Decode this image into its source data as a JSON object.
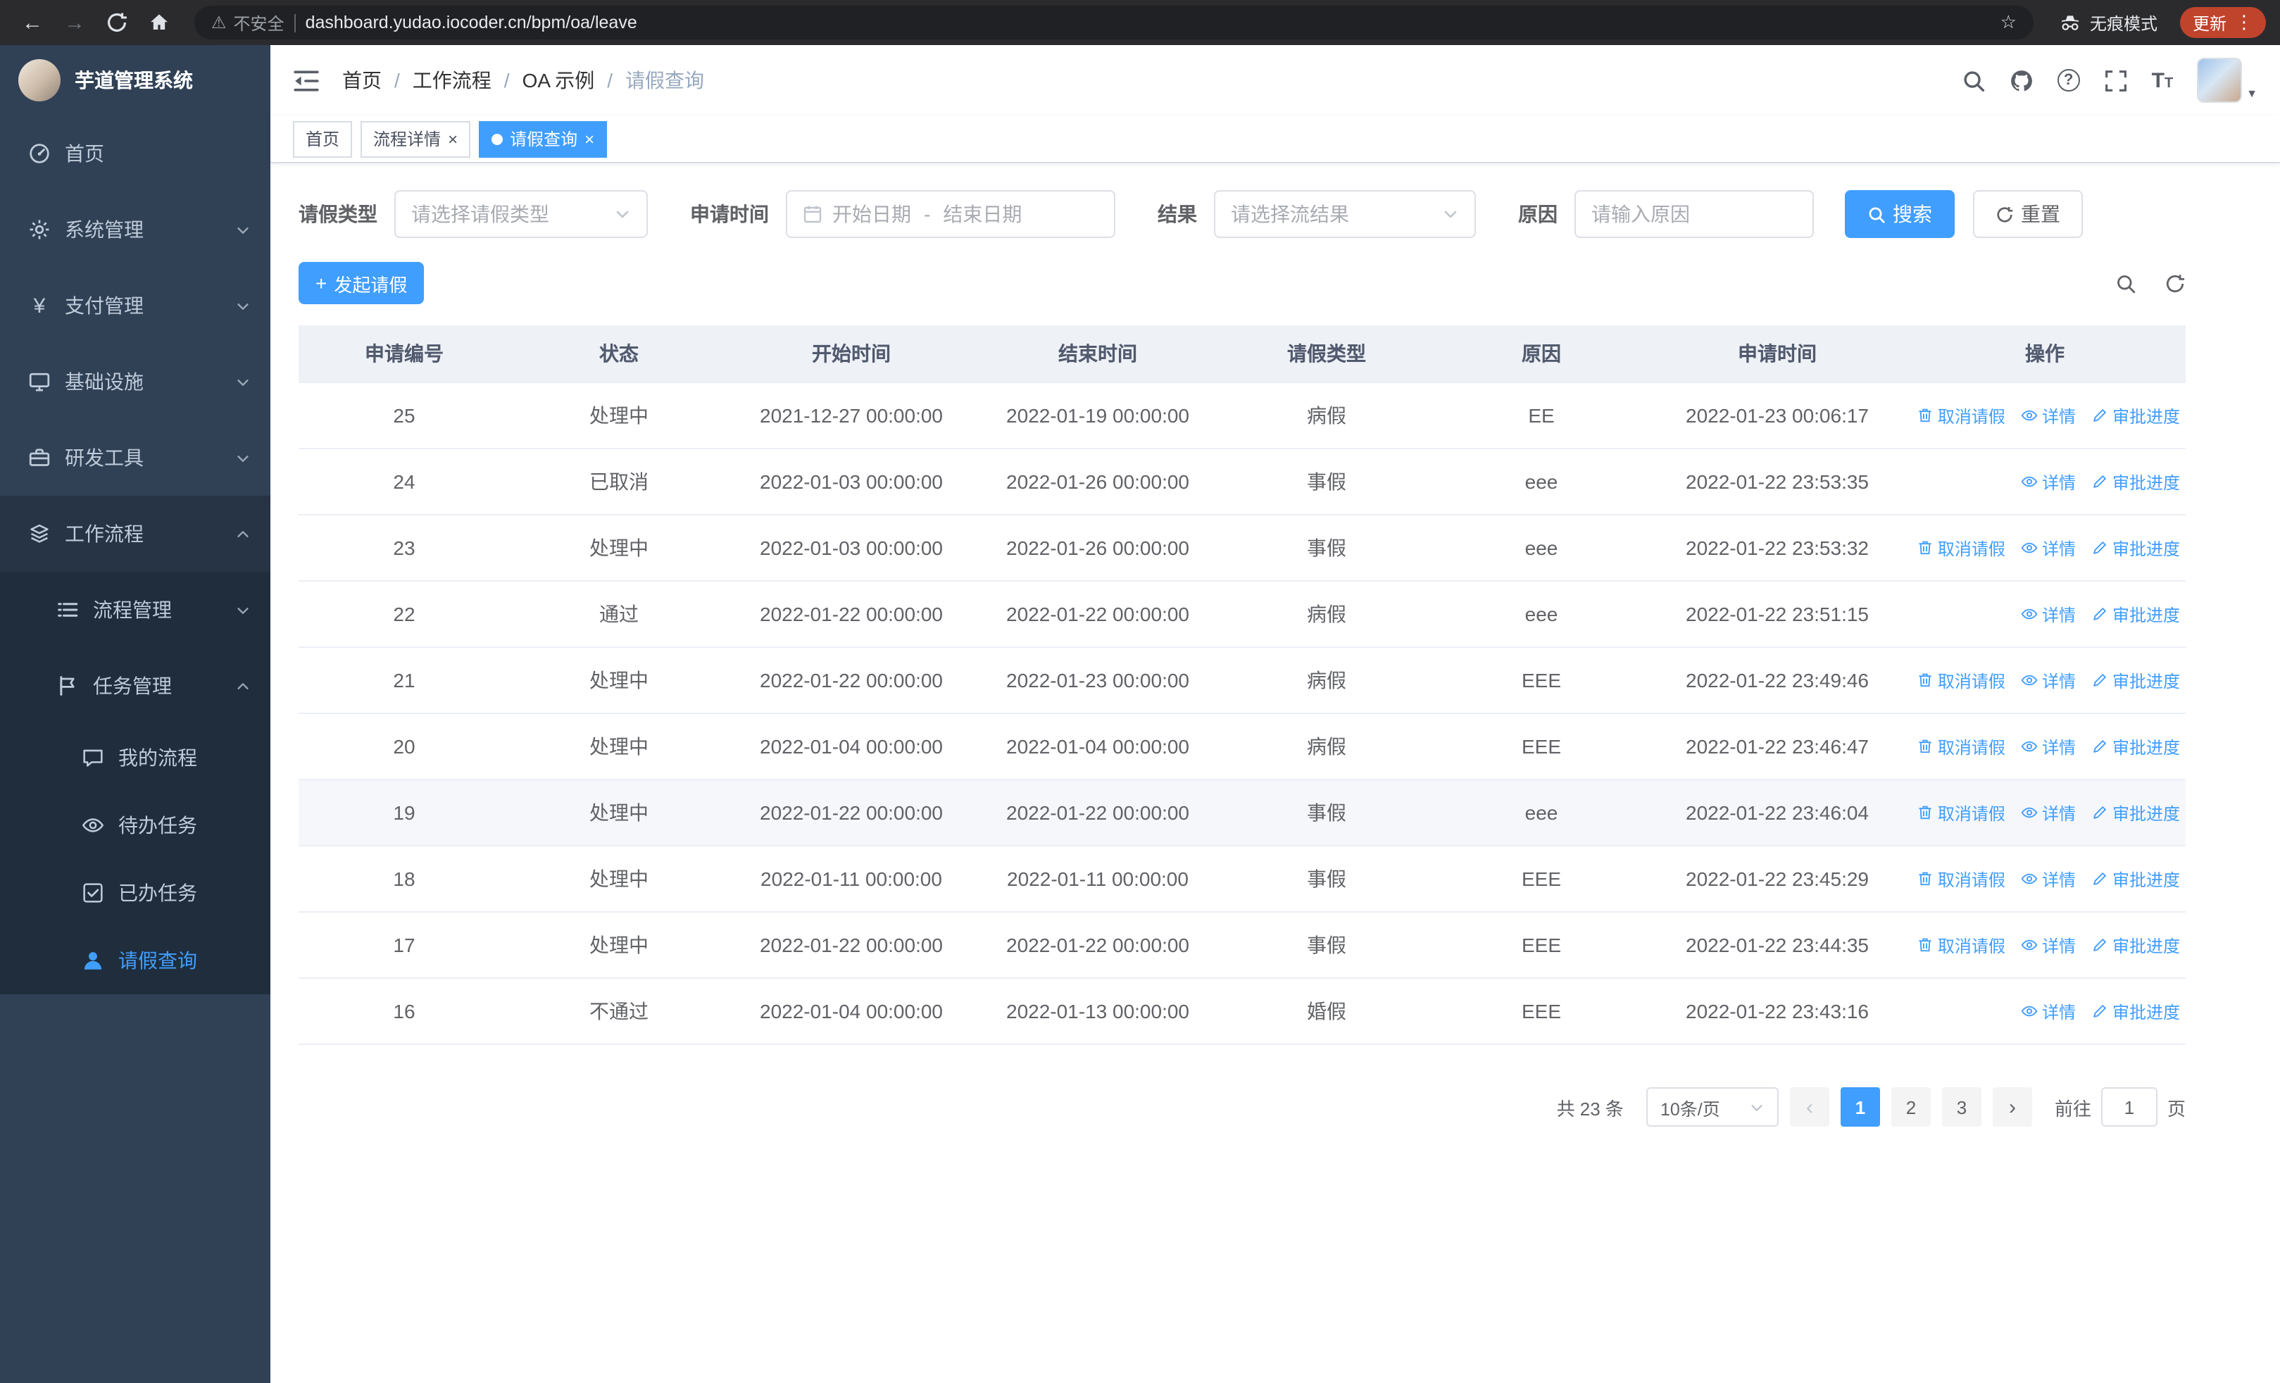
{
  "colors": {
    "primary": "#409eff",
    "sidebar_bg": "#304156",
    "sidebar_sub_bg": "#1f2d3d",
    "update_badge": "#c0432c"
  },
  "browser": {
    "security_label": "不安全",
    "url": "dashboard.yudao.iocoder.cn/bpm/oa/leave",
    "incognito_label": "无痕模式",
    "update_label": "更新"
  },
  "sidebar": {
    "logo_title": "芋道管理系统",
    "items": [
      {
        "label": "首页",
        "icon": "dashboard-icon"
      },
      {
        "label": "系统管理",
        "icon": "gear-icon"
      },
      {
        "label": "支付管理",
        "icon": "yen-icon"
      },
      {
        "label": "基础设施",
        "icon": "monitor-icon"
      },
      {
        "label": "研发工具",
        "icon": "briefcase-icon"
      },
      {
        "label": "工作流程",
        "icon": "workflow-icon"
      }
    ],
    "workflow_children": [
      {
        "label": "流程管理",
        "icon": "list-icon"
      },
      {
        "label": "任务管理",
        "icon": "flag-icon"
      }
    ],
    "task_children": [
      {
        "label": "我的流程",
        "icon": "chat-icon"
      },
      {
        "label": "待办任务",
        "icon": "eye-icon"
      },
      {
        "label": "已办任务",
        "icon": "check-square-icon"
      },
      {
        "label": "请假查询",
        "icon": "user-icon"
      }
    ]
  },
  "header": {
    "breadcrumb": [
      "首页",
      "工作流程",
      "OA 示例",
      "请假查询"
    ]
  },
  "tabs": [
    {
      "label": "首页"
    },
    {
      "label": "流程详情"
    },
    {
      "label": "请假查询"
    }
  ],
  "filters": {
    "type_label": "请假类型",
    "type_placeholder": "请选择请假类型",
    "time_label": "申请时间",
    "start_placeholder": "开始日期",
    "range_separator": "-",
    "end_placeholder": "结束日期",
    "result_label": "结果",
    "result_placeholder": "请选择流结果",
    "reason_label": "原因",
    "reason_placeholder": "请输入原因",
    "search_label": "搜索",
    "reset_label": "重置"
  },
  "toolbar": {
    "create_label": "发起请假"
  },
  "table": {
    "columns": [
      "申请编号",
      "状态",
      "开始时间",
      "结束时间",
      "请假类型",
      "原因",
      "申请时间",
      "操作"
    ],
    "op_labels": {
      "cancel": "取消请假",
      "detail": "详情",
      "progress": "审批进度"
    },
    "rows": [
      {
        "id": "25",
        "status": "处理中",
        "start": "2021-12-27 00:00:00",
        "end": "2022-01-19 00:00:00",
        "type": "病假",
        "reason": "EE",
        "apply_time": "2022-01-23 00:06:17",
        "actions": [
          "cancel",
          "detail",
          "progress"
        ],
        "highlight": false
      },
      {
        "id": "24",
        "status": "已取消",
        "start": "2022-01-03 00:00:00",
        "end": "2022-01-26 00:00:00",
        "type": "事假",
        "reason": "eee",
        "apply_time": "2022-01-22 23:53:35",
        "actions": [
          "detail",
          "progress"
        ],
        "highlight": false
      },
      {
        "id": "23",
        "status": "处理中",
        "start": "2022-01-03 00:00:00",
        "end": "2022-01-26 00:00:00",
        "type": "事假",
        "reason": "eee",
        "apply_time": "2022-01-22 23:53:32",
        "actions": [
          "cancel",
          "detail",
          "progress"
        ],
        "highlight": false
      },
      {
        "id": "22",
        "status": "通过",
        "start": "2022-01-22 00:00:00",
        "end": "2022-01-22 00:00:00",
        "type": "病假",
        "reason": "eee",
        "apply_time": "2022-01-22 23:51:15",
        "actions": [
          "detail",
          "progress"
        ],
        "highlight": false
      },
      {
        "id": "21",
        "status": "处理中",
        "start": "2022-01-22 00:00:00",
        "end": "2022-01-23 00:00:00",
        "type": "病假",
        "reason": "EEE",
        "apply_time": "2022-01-22 23:49:46",
        "actions": [
          "cancel",
          "detail",
          "progress"
        ],
        "highlight": false
      },
      {
        "id": "20",
        "status": "处理中",
        "start": "2022-01-04 00:00:00",
        "end": "2022-01-04 00:00:00",
        "type": "病假",
        "reason": "EEE",
        "apply_time": "2022-01-22 23:46:47",
        "actions": [
          "cancel",
          "detail",
          "progress"
        ],
        "highlight": false
      },
      {
        "id": "19",
        "status": "处理中",
        "start": "2022-01-22 00:00:00",
        "end": "2022-01-22 00:00:00",
        "type": "事假",
        "reason": "eee",
        "apply_time": "2022-01-22 23:46:04",
        "actions": [
          "cancel",
          "detail",
          "progress"
        ],
        "highlight": true
      },
      {
        "id": "18",
        "status": "处理中",
        "start": "2022-01-11 00:00:00",
        "end": "2022-01-11 00:00:00",
        "type": "事假",
        "reason": "EEE",
        "apply_time": "2022-01-22 23:45:29",
        "actions": [
          "cancel",
          "detail",
          "progress"
        ],
        "highlight": false
      },
      {
        "id": "17",
        "status": "处理中",
        "start": "2022-01-22 00:00:00",
        "end": "2022-01-22 00:00:00",
        "type": "事假",
        "reason": "EEE",
        "apply_time": "2022-01-22 23:44:35",
        "actions": [
          "cancel",
          "detail",
          "progress"
        ],
        "highlight": false
      },
      {
        "id": "16",
        "status": "不通过",
        "start": "2022-01-04 00:00:00",
        "end": "2022-01-13 00:00:00",
        "type": "婚假",
        "reason": "EEE",
        "apply_time": "2022-01-22 23:43:16",
        "actions": [
          "detail",
          "progress"
        ],
        "highlight": false
      }
    ]
  },
  "pagination": {
    "total_label": "共 23 条",
    "page_size": "10条/页",
    "pages": [
      "1",
      "2",
      "3"
    ],
    "active_page": "1",
    "goto_label": "前往",
    "goto_value": "1",
    "page_suffix_label": "页"
  }
}
